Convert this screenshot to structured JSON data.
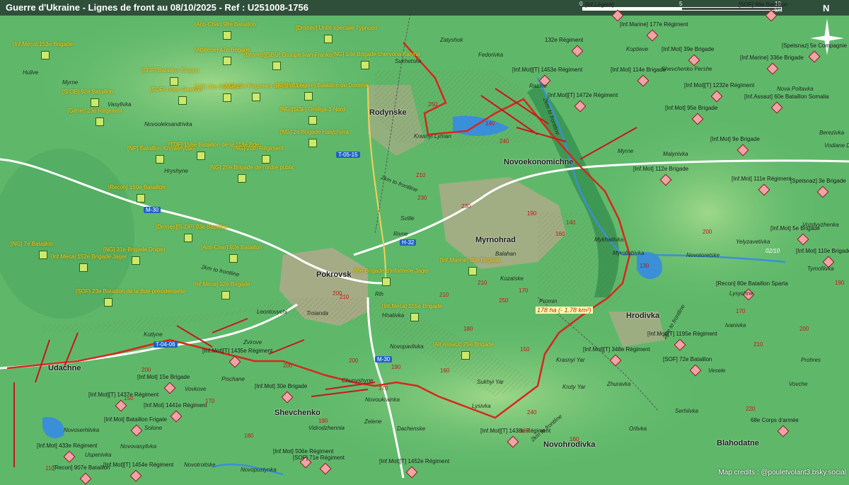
{
  "title": "Guerre d'Ukraine - Lignes de front au 08/10/2025 - Ref : U251008-1756",
  "scale": {
    "labels": [
      "0",
      "5",
      "10 km"
    ]
  },
  "compass": {
    "label": "N"
  },
  "credits": "Map credits : @pouletvolant3.bsky.social",
  "colors": {
    "front_line": "#d8261c",
    "ukraine_label": "#f2d11a",
    "russia_marker": "#f3a2a7",
    "terrain": "#5fb86a",
    "road": "#1f62c7"
  },
  "cities": [
    {
      "name": "Pokrovsk"
    },
    {
      "name": "Myrnohrad"
    },
    {
      "name": "Rodynske"
    },
    {
      "name": "Novoekonomichne"
    },
    {
      "name": "Hrodivka"
    },
    {
      "name": "Shevchenko"
    },
    {
      "name": "Udachne"
    },
    {
      "name": "Novohrodivka"
    },
    {
      "name": "Blahodatne"
    }
  ],
  "towns": [
    "Hulive",
    "Myrne",
    "Vasylivka",
    "Novooleksandrivka",
    "Hryshyne",
    "Zatyshok",
    "Sukhetske",
    "Fedorivka",
    "Krasnyi Lyman",
    "Razine",
    "Koptieve",
    "Shevchenko Pershe",
    "Nova Poltavka",
    "Berezivka",
    "Vodiane Druhe",
    "Myrne",
    "Malynivka",
    "Svitle",
    "Rivne",
    "Balahan",
    "Kozatske",
    "Promin",
    "Myroliubivka",
    "Mykhailivka",
    "Novotoretske",
    "Yelyzavetivka",
    "Vozdvyzhenka",
    "Tymofiivka",
    "Lysychne",
    "Ivanivka",
    "Leontovychi",
    "Troianda",
    "Rih",
    "Hnativka",
    "Kotlyne",
    "Zvirove",
    "Pischane",
    "Vovkove",
    "Chunyshyne",
    "Novoukrainka",
    "Novopavlivka",
    "Sukhyi Yar",
    "Lysivka",
    "Krasnyi Yar",
    "Zhuravka",
    "Serhiivka",
    "Vesele",
    "Prohres",
    "Vovche",
    "Orlivka",
    "Novoserhiivka",
    "Solone",
    "Novovasylivka",
    "Uspenivka",
    "Novotroitske",
    "Novopustynka",
    "Vidrodzhennia",
    "Zelene",
    "Dachenske",
    "Kruty Yar"
  ],
  "roads": [
    "T-05-15",
    "M-30",
    "H-32",
    "T-04-06",
    "M-30"
  ],
  "road_notes": [
    "2km to frontline",
    "2km to frontline",
    "2km to frontline",
    "2km to frontline",
    "2km to frontline"
  ],
  "altitudes": [
    "250",
    "140",
    "240",
    "210",
    "230",
    "230",
    "190",
    "140",
    "160",
    "170",
    "250",
    "210",
    "210",
    "200",
    "210",
    "200",
    "190",
    "160",
    "150",
    "130",
    "190",
    "170",
    "200",
    "210",
    "240",
    "160",
    "160",
    "220",
    "180",
    "110",
    "200",
    "190",
    "170",
    "150",
    "170",
    "200",
    "180",
    "200"
  ],
  "area_note": "178 ha (- 1.78 km²)",
  "date_note": "02/10",
  "ukraine_units": [
    "[Inf.Meca] 153e Brigade",
    "[Anti-Char] 98e Bataillon",
    "[Artillerie] 47e Brigade",
    "[Drones] Unité spéciale Typhoon",
    "[Drones][SBU] Groupe Ivan Franko",
    "[NG] 14e Brigade chervona Kalyna",
    "[SOF] Bataillon Stugna",
    "[SOF] Unité Shaman",
    "[NG] 32e Bataillon",
    "[NG] 29e Régiment de protection",
    "[NP][Inf.Légère] Bataillon de Donetsk",
    "[S-OP] 92e Bataillon",
    "[NG][SOF] Oméga 1 Nord",
    "[Génie] 23e Régiment",
    "[NG] 2e Brigade Halychyna",
    "[NP] Bataillon Khmelnytsky",
    "[TDF] 156e Bataillon de la 118e Bde",
    "[NG] 24th Régiment",
    "[NG] 25e Brigade de l'ordre public",
    "[Recon] 150e Bataillon",
    "[Drones][S-OP] 93e Bataillon",
    "[NG] 7e Bataillon",
    "[NG] 31e Brigade Dnipro",
    "[Anti-Char] 92e Bataillon",
    "[Inf.Meca] 152e Brigade Jager",
    "[Inf.Marine] 38e Brigade",
    "[Inf.Meca] 32e Brigade",
    "68e Brigade d'infanterie Jager",
    "[SOF] 23e Bataillon de la Bde présidentielle",
    "[Inf.Meca] 155e Brigade",
    "[Air Assaut] 25e Brigade"
  ],
  "russia_units": [
    "[Inf.Légère]",
    "[SOF] 96e Bataillon",
    "132e Régiment",
    "[Inf.Marine] 177e Régiment",
    "[Inf.Mot] 39e Brigade",
    "[Inf.Marine] 336e Brigade",
    "[Spetsnaz] 5e Compagnie",
    "[Inf.Mot][T] 1453e Régiment",
    "[Inf.Mot] 114e Brigade",
    "[Inf.Mot][T] 1232e Régiment",
    "[Inf.Assaut] 60e Bataillon Somalia",
    "[Inf.Mot][T] 1472e Régiment",
    "[Inf.Mot] 95e Brigade",
    "[Inf.Mot] 9e Brigade",
    "[Inf.Mot] 112e Brigade",
    "[Inf.Mot] 111e Régiment",
    "[Spetsnaz] 3e Brigade",
    "[Inf.Mot] 5e Brigade",
    "[Inf.Mot] 110e Brigade",
    "[Recon] 80e Bataillon Sparta",
    "[Inf.Mot][T] 1195e Régiment",
    "[Inf.Mot][T] 348e Régiment",
    "[SOF] 72e Bataillon",
    "[Inf.Mot][T] 1435e Régiment",
    "[Inf.Mot] 30e Brigade",
    "[Inf.Mot] 15e Brigade",
    "[Inf.Mot][T] 1437e Régiment",
    "[Inf.Mot] 1441e Régiment",
    "[Inf.Mot] Bataillon Frigate",
    "[Inf.Mot] 433e Régiment",
    "[Recon] 907e Bataillon",
    "[Inf.Mot][T] 1454e Régiment",
    "[Inf.Mot] 506e Régiment",
    "[SOF] 71e Régiment",
    "[Inf.Mot][T] 1452e Régiment",
    "[Inf.Mot][T] 1438e Régiment",
    "68e Corps d'armée"
  ]
}
